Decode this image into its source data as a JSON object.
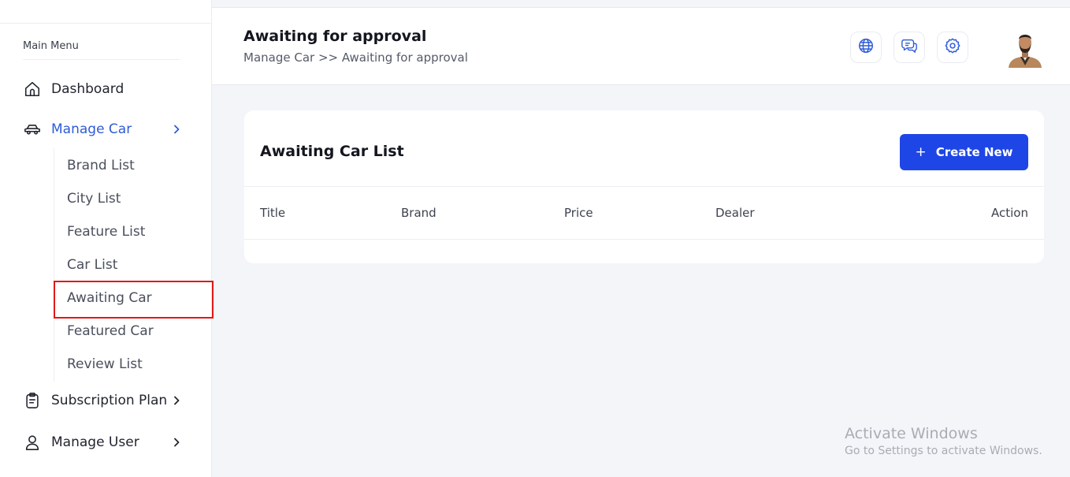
{
  "sidebar": {
    "heading": "Main Menu",
    "items": [
      {
        "label": "Dashboard",
        "icon": "home-icon"
      },
      {
        "label": "Manage Car",
        "icon": "car-icon"
      },
      {
        "label": "Subscription Plan",
        "icon": "clipboard-icon"
      },
      {
        "label": "Manage User",
        "icon": "user-icon"
      }
    ],
    "submenu": [
      "Brand List",
      "City List",
      "Feature List",
      "Car List",
      "Awaiting Car",
      "Featured Car",
      "Review List"
    ],
    "active_item": "Manage Car",
    "highlighted_subitem": "Awaiting Car"
  },
  "header": {
    "title": "Awaiting for approval",
    "breadcrumb": "Manage Car >> Awaiting for approval",
    "icons": [
      "globe-icon",
      "chat-icon",
      "gear-icon"
    ]
  },
  "card": {
    "title": "Awaiting Car List",
    "create_label": "Create New",
    "columns": [
      "Title",
      "Brand",
      "Price",
      "Dealer",
      "Action"
    ]
  },
  "watermark": {
    "title": "Activate Windows",
    "subtitle": "Go to Settings to activate Windows."
  },
  "colors": {
    "accent": "#1e46e6",
    "active_nav": "#2e5bd8",
    "highlight_border": "#e01818",
    "background": "#f3f5f9"
  }
}
